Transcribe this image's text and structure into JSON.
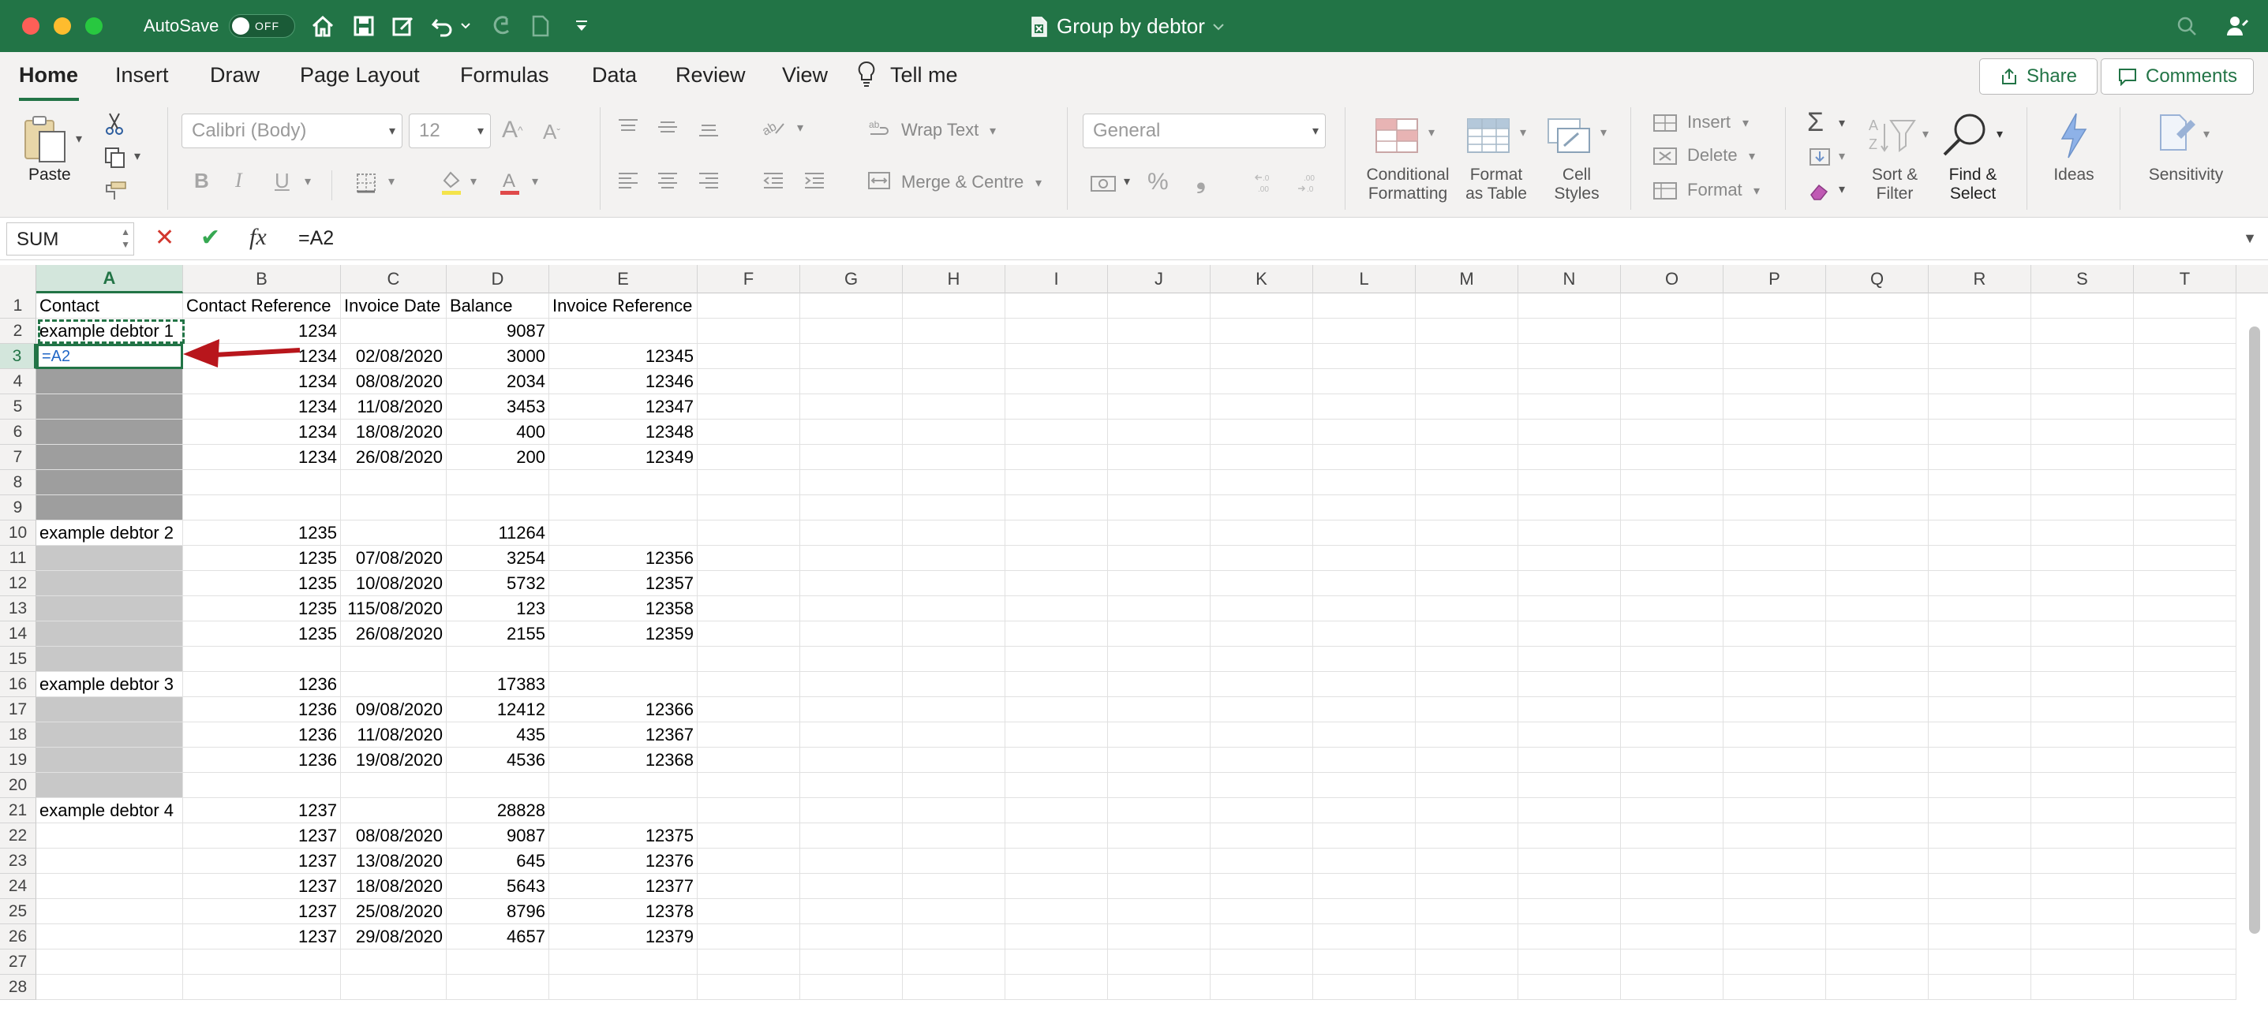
{
  "titlebar": {
    "autosave_label": "AutoSave",
    "autosave_state": "OFF",
    "document_title": "Group by debtor",
    "qat_icons": [
      "home-icon",
      "save-icon",
      "edit-icon",
      "undo-icon",
      "redo-icon",
      "new-doc-icon",
      "customize-icon"
    ]
  },
  "tabs": [
    {
      "label": "Home",
      "active": true
    },
    {
      "label": "Insert"
    },
    {
      "label": "Draw"
    },
    {
      "label": "Page Layout"
    },
    {
      "label": "Formulas"
    },
    {
      "label": "Data"
    },
    {
      "label": "Review"
    },
    {
      "label": "View"
    },
    {
      "label": "Tell me"
    }
  ],
  "actions": {
    "share": "Share",
    "comments": "Comments"
  },
  "ribbon": {
    "paste": "Paste",
    "font_name": "Calibri (Body)",
    "font_size": "12",
    "wrap_text": "Wrap Text",
    "merge_centre": "Merge & Centre",
    "number_format": "General",
    "conditional_formatting_1": "Conditional",
    "conditional_formatting_2": "Formatting",
    "format_as_table_1": "Format",
    "format_as_table_2": "as Table",
    "cell_styles_1": "Cell",
    "cell_styles_2": "Styles",
    "insert": "Insert",
    "delete": "Delete",
    "format": "Format",
    "sort_filter_1": "Sort &",
    "sort_filter_2": "Filter",
    "find_select_1": "Find &",
    "find_select_2": "Select",
    "ideas": "Ideas",
    "sensitivity": "Sensitivity",
    "bold": "B",
    "italic": "I",
    "underline": "U"
  },
  "formula_bar": {
    "name_box": "SUM",
    "formula": "=A2",
    "fx": "fx"
  },
  "sheet": {
    "columns": [
      "A",
      "B",
      "C",
      "D",
      "E",
      "F",
      "G",
      "H",
      "I",
      "J",
      "K",
      "L",
      "M",
      "N",
      "O",
      "P",
      "Q",
      "R",
      "S",
      "T"
    ],
    "row_numbers": [
      "1",
      "2",
      "3",
      "4",
      "5",
      "6",
      "7",
      "8",
      "9",
      "10",
      "11",
      "12",
      "13",
      "14",
      "15",
      "16",
      "17",
      "18",
      "19",
      "20",
      "21",
      "22",
      "23",
      "24",
      "25",
      "26",
      "27",
      "28"
    ],
    "rows": [
      [
        "Contact",
        "Contact Reference",
        "Invoice Date",
        "Balance",
        "Invoice Reference"
      ],
      [
        "example debtor 1",
        "1234",
        "",
        "9087",
        ""
      ],
      [
        "=A2",
        "1234",
        "02/08/2020",
        "3000",
        "12345"
      ],
      [
        "",
        "1234",
        "08/08/2020",
        "2034",
        "12346"
      ],
      [
        "",
        "1234",
        "11/08/2020",
        "3453",
        "12347"
      ],
      [
        "",
        "1234",
        "18/08/2020",
        "400",
        "12348"
      ],
      [
        "",
        "1234",
        "26/08/2020",
        "200",
        "12349"
      ],
      [
        "",
        "",
        "",
        "",
        ""
      ],
      [
        "",
        "",
        "",
        "",
        ""
      ],
      [
        "example debtor 2",
        "1235",
        "",
        "11264",
        ""
      ],
      [
        "",
        "1235",
        "07/08/2020",
        "3254",
        "12356"
      ],
      [
        "",
        "1235",
        "10/08/2020",
        "5732",
        "12357"
      ],
      [
        "",
        "1235",
        "115/08/2020",
        "123",
        "12358"
      ],
      [
        "",
        "1235",
        "26/08/2020",
        "2155",
        "12359"
      ],
      [
        "",
        "",
        "",
        "",
        ""
      ],
      [
        "example debtor 3",
        "1236",
        "",
        "17383",
        ""
      ],
      [
        "",
        "1236",
        "09/08/2020",
        "12412",
        "12366"
      ],
      [
        "",
        "1236",
        "11/08/2020",
        "435",
        "12367"
      ],
      [
        "",
        "1236",
        "19/08/2020",
        "4536",
        "12368"
      ],
      [
        "",
        "",
        "",
        "",
        ""
      ],
      [
        "example debtor 4",
        "1237",
        "",
        "28828",
        ""
      ],
      [
        "",
        "1237",
        "08/08/2020",
        "9087",
        "12375"
      ],
      [
        "",
        "1237",
        "13/08/2020",
        "645",
        "12376"
      ],
      [
        "",
        "1237",
        "18/08/2020",
        "5643",
        "12377"
      ],
      [
        "",
        "1237",
        "25/08/2020",
        "8796",
        "12378"
      ],
      [
        "",
        "1237",
        "29/08/2020",
        "4657",
        "12379"
      ],
      [
        "",
        "",
        "",
        "",
        ""
      ],
      [
        "",
        "",
        "",
        "",
        ""
      ]
    ],
    "fill": {
      "dark_rows": [
        4,
        5,
        6,
        7,
        8,
        9
      ],
      "mid_rows": [
        11,
        12,
        13,
        14,
        15,
        17,
        18,
        19,
        20
      ]
    }
  },
  "colors": {
    "accent": "#227446",
    "arrow": "#b8161c",
    "formula_ref": "#2167c6"
  }
}
